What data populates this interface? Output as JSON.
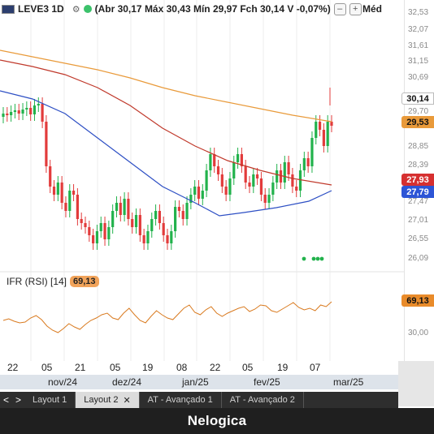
{
  "header": {
    "ticker": "LEVE3 1D",
    "ohlc": "(Abr 30,17 Máx 30,43 Mín 29,97 Fch 30,14 V -0,07%)",
    "mode": "Méd"
  },
  "price_axis": [
    "32,53",
    "32,07",
    "31,61",
    "31,15",
    "30,69",
    "29,70",
    "28,85",
    "28,39",
    "27,47",
    "27,01",
    "26,55",
    "26,09"
  ],
  "tags": {
    "last": "30,14",
    "ma_orange": "29,53",
    "ma_red": "27,93",
    "ma_blue": "27,79",
    "rsi": "69,13"
  },
  "rsi": {
    "label": "IFR (RSI) [14]",
    "value": "69,13",
    "axis_label": "30,00"
  },
  "x_axis": {
    "days": [
      "22",
      "05",
      "21",
      "05",
      "19",
      "08",
      "22",
      "05",
      "19",
      "07"
    ],
    "months": [
      "nov/24",
      "dez/24",
      "jan/25",
      "fev/25",
      "mar/25"
    ]
  },
  "tabs": {
    "items": [
      "Layout 1",
      "Layout 2",
      "AT - Avançado 1",
      "AT - Avançado 2"
    ],
    "active": "Layout 2"
  },
  "footer": {
    "brand": "Nelogica"
  },
  "colors": {
    "up": "#22b24c",
    "down": "#e23b3b",
    "ma_orange": "#e99a3a",
    "ma_red": "#c0392b",
    "ma_blue": "#2d4fc4",
    "rsi_line": "#d97a1f"
  }
}
